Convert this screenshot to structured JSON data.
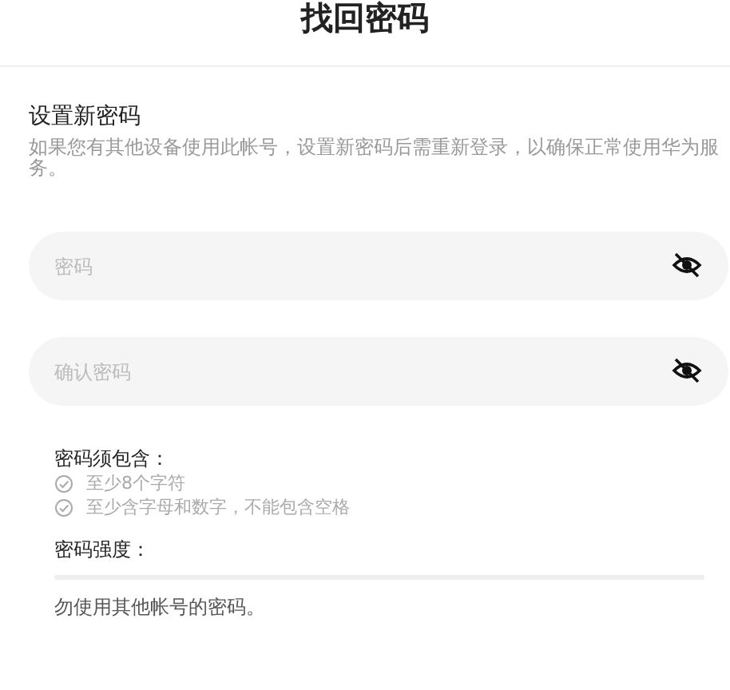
{
  "title": "找回密码",
  "heading": "设置新密码",
  "description": "如果您有其他设备使用此帐号，设置新密码后需重新登录，以确保正常使用华为服务。",
  "fields": [
    {
      "placeholder": "密码",
      "visible": false
    },
    {
      "placeholder": "确认密码",
      "visible": false
    }
  ],
  "requirements": {
    "label": "密码须包含：",
    "items": [
      {
        "text": "至少8个字符",
        "met": false
      },
      {
        "text": "至少含字母和数字，不能包含空格",
        "met": false
      }
    ]
  },
  "strength": {
    "label": "密码强度：",
    "level": 0
  },
  "note": "勿使用其他帐号的密码。"
}
